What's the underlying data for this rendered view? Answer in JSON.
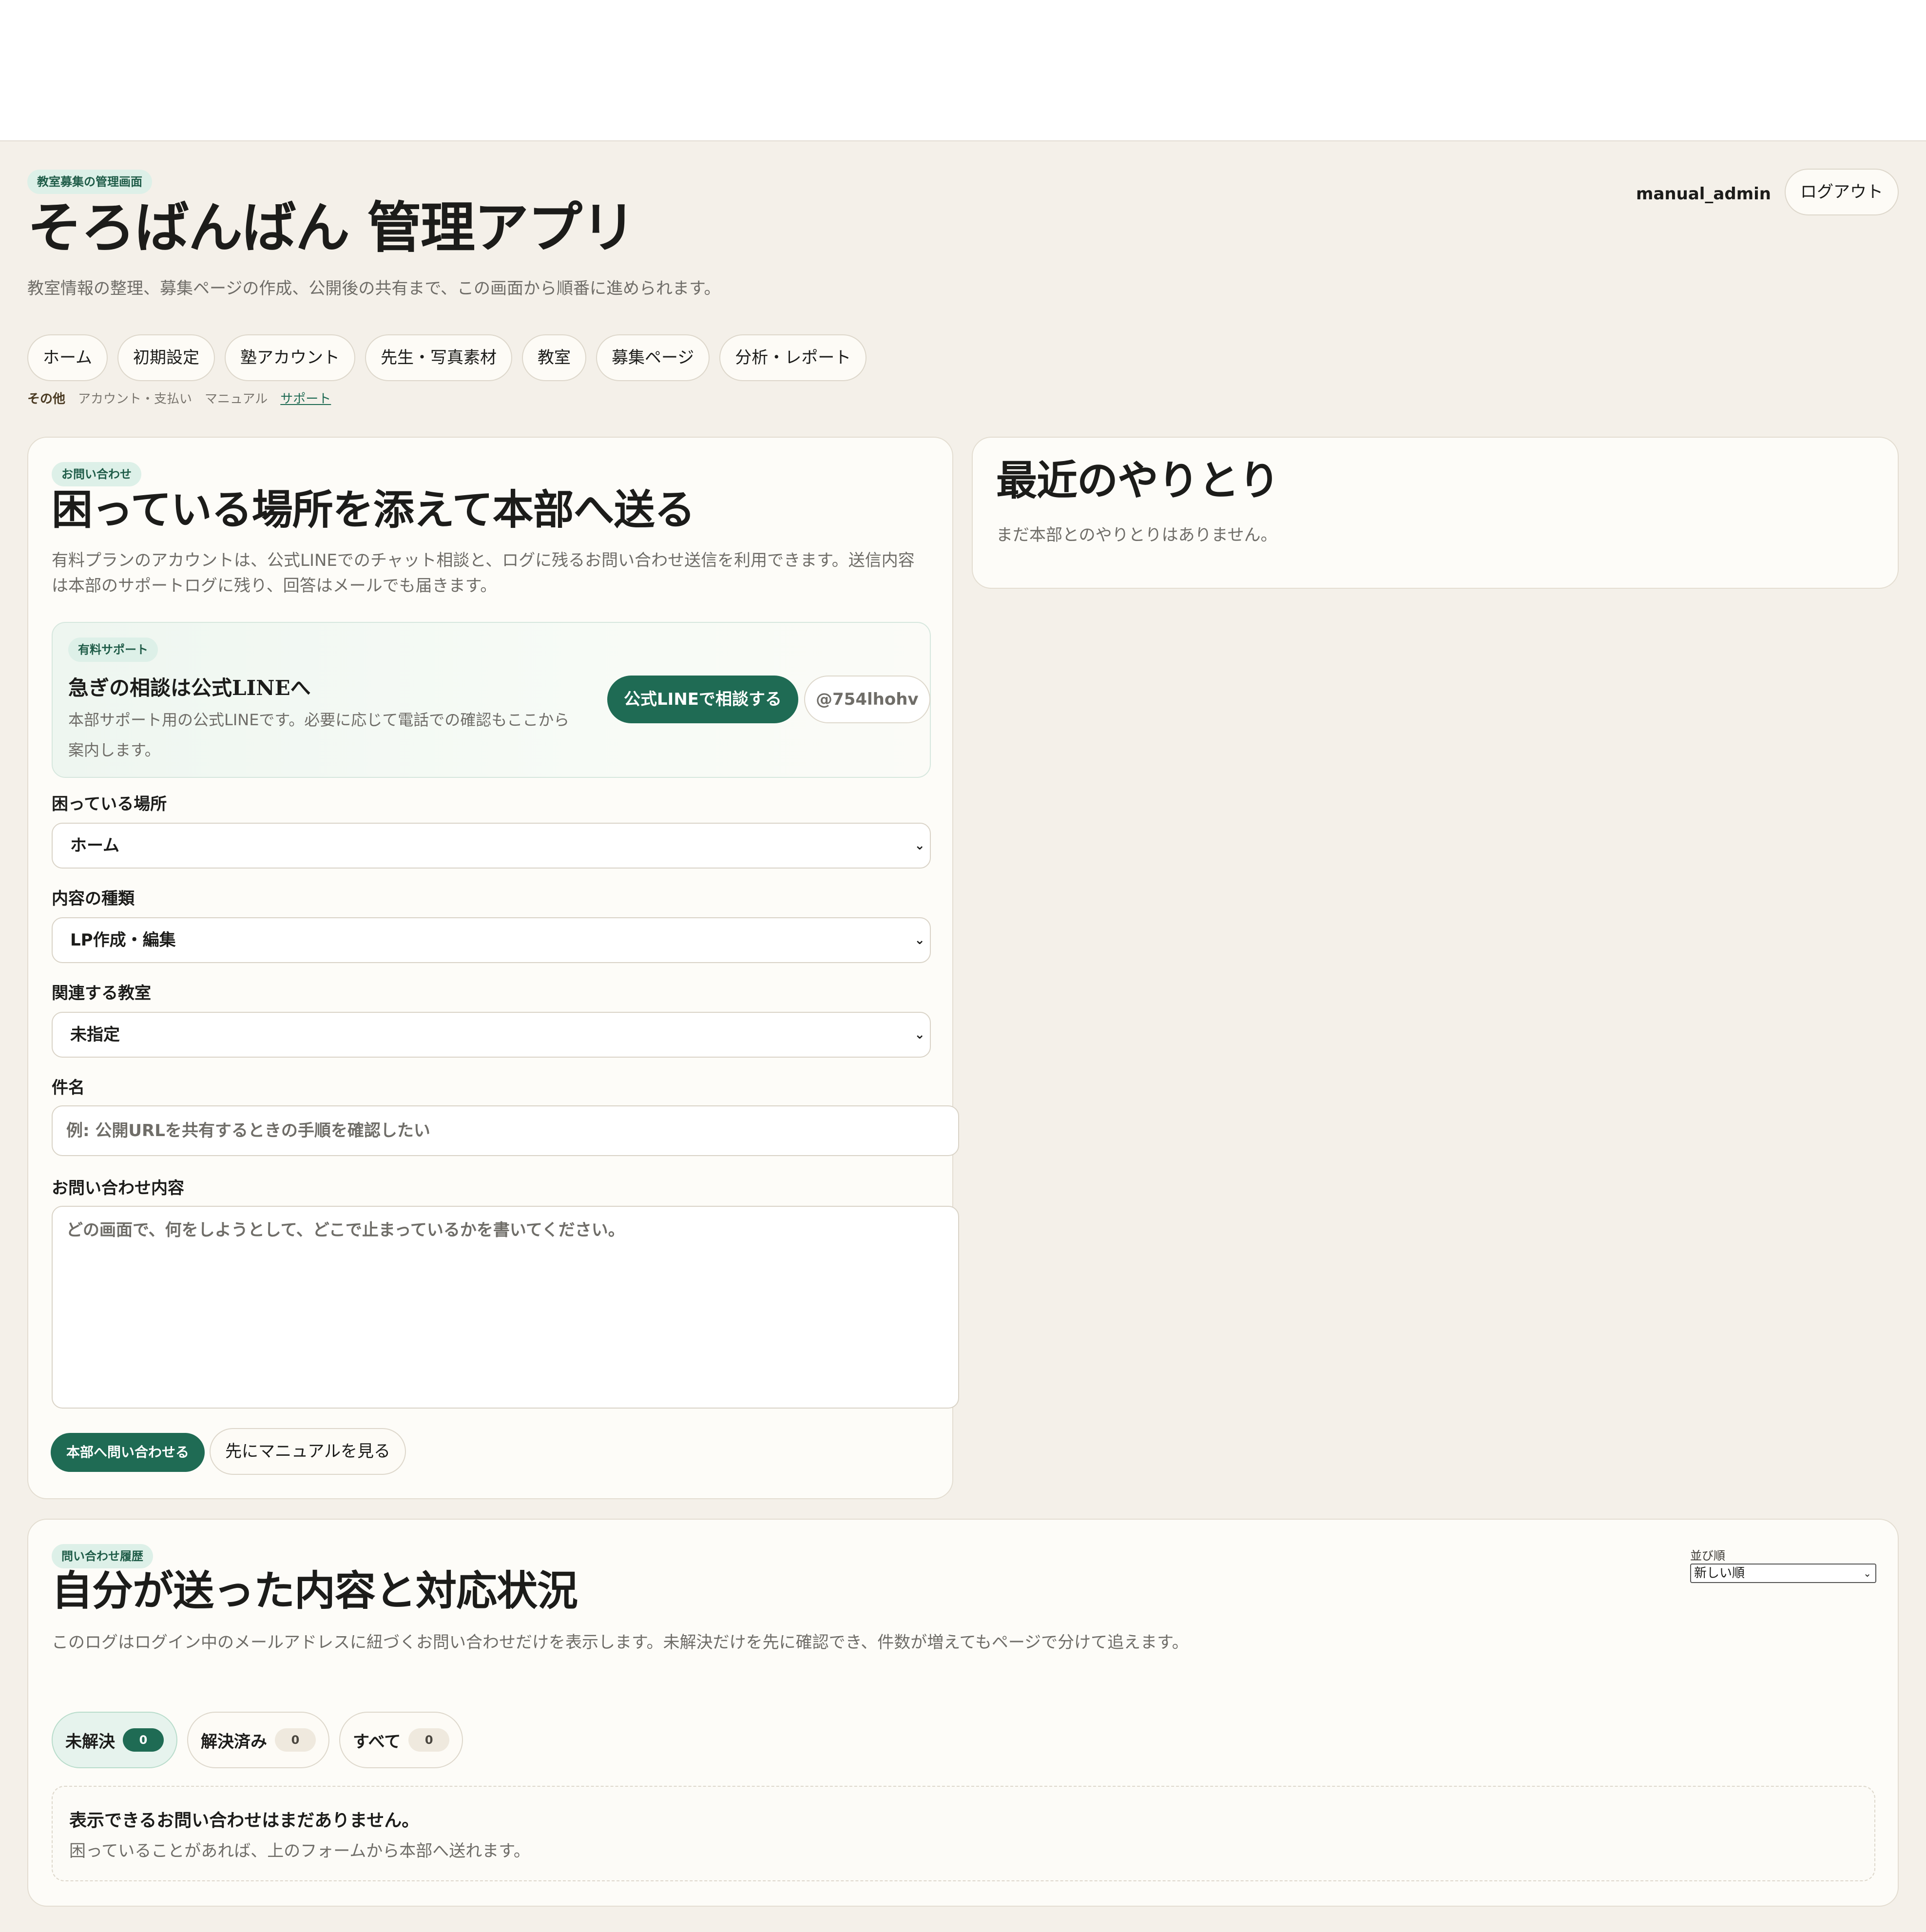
{
  "header": {
    "chip": "教室募集の管理画面",
    "title": "そろばんばん 管理アプリ",
    "subtitle": "教室情報の整理、募集ページの作成、公開後の共有まで、この画面から順番に進められます。",
    "user": "manual_admin",
    "logout": "ログアウト"
  },
  "nav": {
    "items": [
      "ホーム",
      "初期設定",
      "塾アカウント",
      "先生・写真素材",
      "教室",
      "募集ページ",
      "分析・レポート"
    ],
    "sub_label": "その他",
    "sub_items": [
      "アカウント・支払い",
      "マニュアル",
      "サポート"
    ]
  },
  "form": {
    "chip": "お問い合わせ",
    "title": "困っている場所を添えて本部へ送る",
    "desc": "有料プランのアカウントは、公式LINEでのチャット相談と、ログに残るお問い合わせ送信を利用できます。送信内容は本部のサポートログに残り、回答はメールでも届きます。",
    "line": {
      "chip": "有料サポート",
      "title": "急ぎの相談は公式LINEへ",
      "desc": "本部サポート用の公式LINEです。必要に応じて電話での確認もここから案内します。",
      "button": "公式LINEで相談する",
      "id": "@754lhohv"
    },
    "place_label": "困っている場所",
    "place_value": "ホーム",
    "type_label": "内容の種類",
    "type_value": "LP作成・編集",
    "room_label": "関連する教室",
    "room_value": "未指定",
    "subject_label": "件名",
    "subject_placeholder": "例: 公開URLを共有するときの手順を確認したい",
    "body_label": "お問い合わせ内容",
    "body_placeholder": "どの画面で、何をしようとして、どこで止まっているかを書いてください。",
    "submit": "本部へ問い合わせる",
    "manual": "先にマニュアルを見る"
  },
  "recent": {
    "title": "最近のやりとり",
    "empty": "まだ本部とのやりとりはありません。"
  },
  "history": {
    "chip": "問い合わせ履歴",
    "title": "自分が送った内容と対応状況",
    "desc": "このログはログイン中のメールアドレスに紐づくお問い合わせだけを表示します。未解決だけを先に確認でき、件数が増えてもページで分けて追えます。",
    "sort_label": "並び順",
    "sort_value": "新しい順",
    "tabs": [
      {
        "label": "未解決",
        "count": "0"
      },
      {
        "label": "解決済み",
        "count": "0"
      },
      {
        "label": "すべて",
        "count": "0"
      }
    ],
    "empty_title": "表示できるお問い合わせはまだありません。",
    "empty_desc": "困っていることがあれば、上のフォームから本部へ送れます。"
  },
  "colors": {
    "accent": "#1f6b54",
    "background": "#f4f0e9",
    "chip_bg": "#ddf0e8"
  }
}
